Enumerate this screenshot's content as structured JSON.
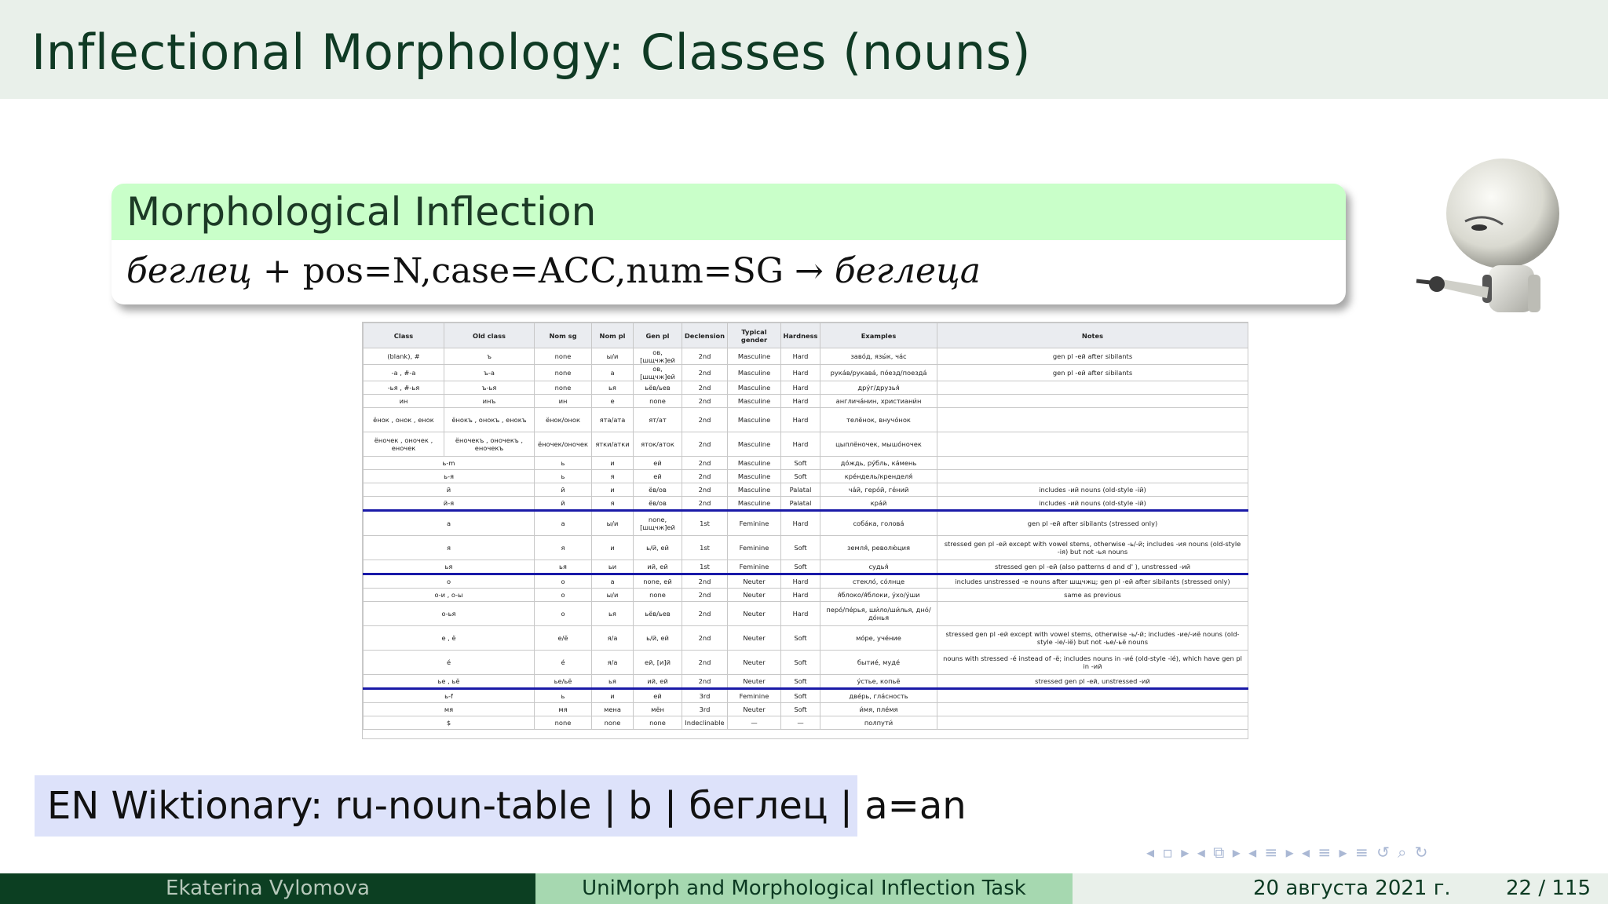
{
  "header": {
    "title": "Inflectional Morphology: Classes (nouns)"
  },
  "block": {
    "title": "Morphological Inflection",
    "lemma": "беглец",
    "features": "+ pos=N,case=ACC,num=SG",
    "arrow": "→",
    "form": "беглеца"
  },
  "table": {
    "headers": [
      "Class",
      "Old class",
      "Nom sg",
      "Nom pl",
      "Gen pl",
      "Declension",
      "Typical gender",
      "Hardness",
      "Examples",
      "Notes"
    ],
    "rows": [
      [
        "(blank), #",
        "ъ",
        "none",
        "ы/и",
        "ов, [шщчж]ей",
        "2nd",
        "Masculine",
        "Hard",
        "заво́д, язы́к, ча́с",
        "gen pl -ей after sibilants"
      ],
      [
        "-а , #-а",
        "ъ-а",
        "none",
        "а",
        "ов, [шщчж]ей",
        "2nd",
        "Masculine",
        "Hard",
        "рука́в/рукава́, по́езд/поезда́",
        "gen pl -ей after sibilants"
      ],
      [
        "-ья , #-ья",
        "ъ-ья",
        "none",
        "ья",
        "ьёв/ьев",
        "2nd",
        "Masculine",
        "Hard",
        "дру́г/друзья́",
        ""
      ],
      [
        "ин",
        "инъ",
        "ин",
        "е",
        "none",
        "2nd",
        "Masculine",
        "Hard",
        "англича́нин, христиани́н",
        ""
      ],
      [
        "ёнок , онок , енок",
        "ёнокъ , онокъ , енокъ",
        "ёнок/онок",
        "ята/ата",
        "ят/ат",
        "2nd",
        "Masculine",
        "Hard",
        "телёнок, внучо́нок",
        ""
      ],
      [
        "ёночек , оночек , еночек",
        "ёночекъ , оночекъ , еночекъ",
        "ёночек/оночек",
        "ятки/атки",
        "яток/аток",
        "2nd",
        "Masculine",
        "Hard",
        "цыплёночек, мышо́ночек",
        ""
      ],
      [
        "ь-m",
        "",
        "ь",
        "и",
        "ей",
        "2nd",
        "Masculine",
        "Soft",
        "до́ждь, ру́бль, ка́мень",
        ""
      ],
      [
        "ь-я",
        "",
        "ь",
        "я",
        "ей",
        "2nd",
        "Masculine",
        "Soft",
        "кре́ндель/кренделя́",
        ""
      ],
      [
        "й",
        "",
        "й",
        "и",
        "ёв/ов",
        "2nd",
        "Masculine",
        "Palatal",
        "ча́й, геро́й, ге́ний",
        "includes -ий nouns (old-style -ій)"
      ],
      [
        "й-я",
        "",
        "й",
        "я",
        "ёв/ов",
        "2nd",
        "Masculine",
        "Palatal",
        "кра́й",
        "includes -ий nouns (old-style -ій)"
      ],
      [
        "а",
        "",
        "а",
        "ы/и",
        "none, [шщчж]ей",
        "1st",
        "Feminine",
        "Hard",
        "соба́ка, голова́",
        "gen pl -ей after sibilants (stressed only)"
      ],
      [
        "я",
        "",
        "я",
        "и",
        "ь/й, ей",
        "1st",
        "Feminine",
        "Soft",
        "земля́, револю́ция",
        "stressed gen pl -ей except with vowel stems, otherwise -ь/-й; includes -ия nouns (old-style -ія) but not -ья nouns"
      ],
      [
        "ья",
        "",
        "ья",
        "ьи",
        "ий, ей",
        "1st",
        "Feminine",
        "Soft",
        "судья́",
        "stressed gen pl -ей (also patterns d and d' ), unstressed -ий"
      ],
      [
        "о",
        "",
        "о",
        "а",
        "none, ей",
        "2nd",
        "Neuter",
        "Hard",
        "стекло́, со́лнце",
        "includes unstressed -е nouns after шщчжц; gen pl -ей after sibilants (stressed only)"
      ],
      [
        "о-и , о-ы",
        "",
        "о",
        "ы/и",
        "none",
        "2nd",
        "Neuter",
        "Hard",
        "я́блоко/я́блоки, у́хо/у́ши",
        "same as previous"
      ],
      [
        "о-ья",
        "",
        "о",
        "ья",
        "ьёв/ьев",
        "2nd",
        "Neuter",
        "Hard",
        "перо́/пе́рья, ши́ло/ши́лья, дно́/до́нья",
        ""
      ],
      [
        "е , ё",
        "",
        "е/ё",
        "я/а",
        "ь/й, ей",
        "2nd",
        "Neuter",
        "Soft",
        "мо́ре, уче́ние",
        "stressed gen pl -ей except with vowel stems, otherwise -ь/-й; includes -ие/-иё nouns (old-style -іе/-іё) but not -ье/-ьё nouns"
      ],
      [
        "é",
        "",
        "é",
        "я/а",
        "ей, [и]й",
        "2nd",
        "Neuter",
        "Soft",
        "бытие́, муде́",
        "nouns with stressed -é instead of -ё; includes nouns in -ие́ (old-style -іе́), which have gen pl in -ий"
      ],
      [
        "ье , ьё",
        "",
        "ье/ьё",
        "ья",
        "ий, ей",
        "2nd",
        "Neuter",
        "Soft",
        "у́стье, копьё",
        "stressed gen pl -ей, unstressed -ий"
      ],
      [
        "ь-f",
        "",
        "ь",
        "и",
        "ей",
        "3rd",
        "Feminine",
        "Soft",
        "две́рь, гла́сность",
        ""
      ],
      [
        "мя",
        "",
        "мя",
        "мена",
        "мён",
        "3rd",
        "Neuter",
        "Soft",
        "и́мя, пле́мя",
        ""
      ],
      [
        "$",
        "",
        "none",
        "none",
        "none",
        "Indeclinable",
        "—",
        "—",
        "полпути́",
        ""
      ]
    ]
  },
  "wiktionary": {
    "text": "EN Wiktionary: ru-noun-table | b | беглец | a=an"
  },
  "nav": {
    "symbols": "◂ ▫ ▸  ◂ ⧉ ▸  ◂ ≡ ▸  ◂ ≡ ▸   ≡   ↺ ⌕ ↻"
  },
  "footer": {
    "author": "Ekaterina Vylomova",
    "title": "UniMorph and Morphological Inflection Task",
    "date": "20 августа 2021 г.",
    "page": "22 / 115"
  },
  "colors": {
    "header_bg": "#e9f0ea",
    "block_head_bg": "#c9ffc9",
    "wiktionary_bg": "#dde2fa",
    "footer_dark": "#0c3f22",
    "footer_mid": "#a6d8b0",
    "table_separator": "#1a1aa8"
  }
}
